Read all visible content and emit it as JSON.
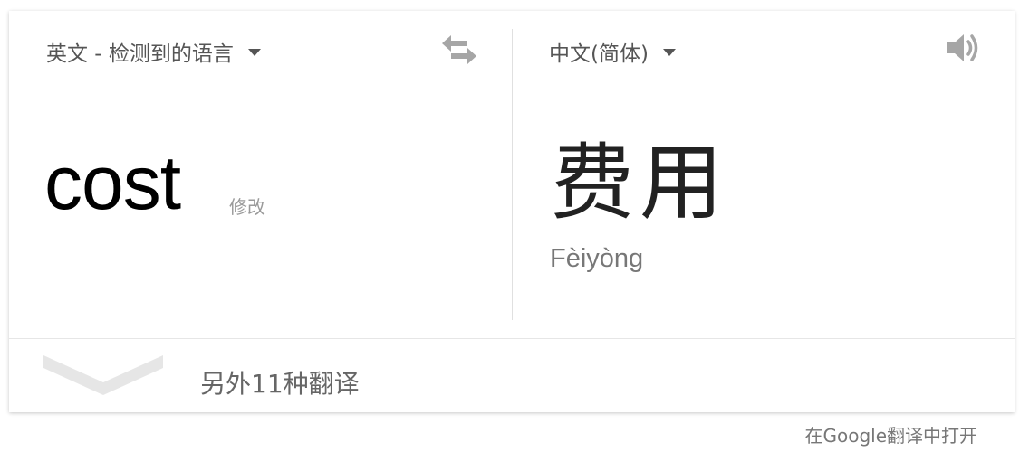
{
  "source": {
    "language_label": "英文 - 检测到的语言",
    "text": "cost",
    "edit_label": "修改"
  },
  "target": {
    "language_label": "中文(简体)",
    "text": "费用",
    "romanization": "Fèiyòng"
  },
  "more": {
    "label": "另外11种翻译"
  },
  "footer": {
    "open_link": "在Google翻译中打开"
  },
  "icons": {
    "swap": "swap-arrows-icon",
    "speaker": "speaker-icon",
    "caret": "caret-down-icon",
    "expand": "chevron-down-icon"
  },
  "colors": {
    "icon_gray": "#a6a6a6",
    "chevron_gray": "#e6e6e6"
  }
}
